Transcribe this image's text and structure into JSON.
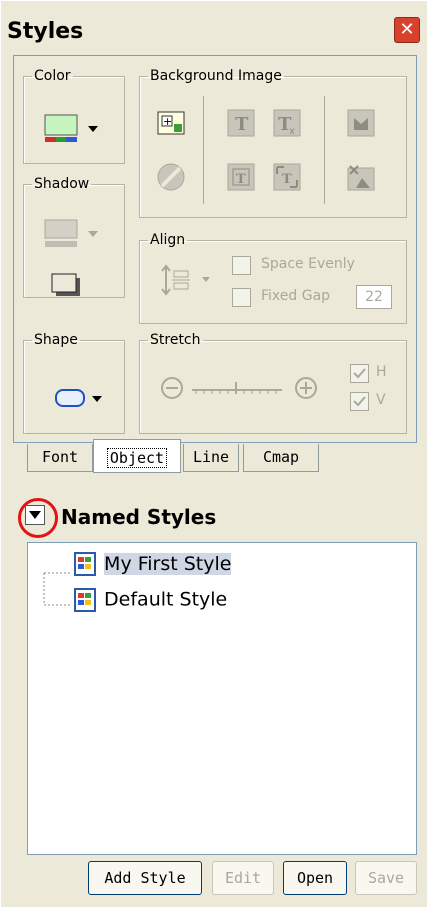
{
  "window": {
    "title": "Styles",
    "close_glyph": "✕"
  },
  "groups": {
    "color": "Color",
    "background": "Background Image",
    "shadow": "Shadow",
    "align": "Align",
    "shape": "Shape",
    "stretch": "Stretch"
  },
  "align": {
    "space_evenly": "Space Evenly",
    "fixed_gap": "Fixed Gap",
    "gap_value": "22"
  },
  "stretch": {
    "h": "H",
    "v": "V",
    "h_checked": true,
    "v_checked": true
  },
  "tabs": [
    {
      "label": "Font",
      "active": false
    },
    {
      "label": "Object",
      "active": true
    },
    {
      "label": "Line",
      "active": false
    },
    {
      "label": "Cmap",
      "active": false
    }
  ],
  "named_styles": {
    "header": "Named Styles",
    "items": [
      {
        "label": "My First Style",
        "selected": true
      },
      {
        "label": "Default Style",
        "selected": false
      }
    ]
  },
  "buttons": {
    "add_style": "Add Style",
    "edit": "Edit",
    "open": "Open",
    "save": "Save"
  },
  "colors": {
    "fill_swatch": "#c6f5c0",
    "highlight_circle": "#e01414",
    "selection": "#cfd6e4"
  }
}
